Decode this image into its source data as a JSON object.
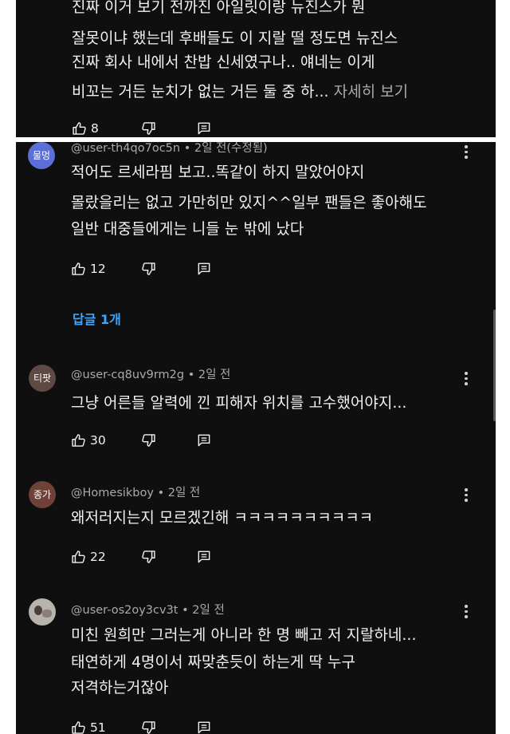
{
  "top_comment": {
    "lines": [
      "진짜 이거 보기 전까진 아일릿이랑 뉴진스가 뭔",
      "잘못이냐 했는데 후배들도 이 지랄 떨 정도면 뉴진스",
      "진짜 회사 내에서 찬밥 신세였구나.. 얘네는 이게",
      "비꼬는 거든 눈치가 없는 거든 둘 중 하..."
    ],
    "read_more": "자세히 보기",
    "likes": "8"
  },
  "comments": [
    {
      "avatar_text": "물멍",
      "avatar_color": "#5b6fd6",
      "meta": "@user-th4qo7oc5n • 2일 전(수정됨)",
      "lines": [
        "적어도 르세라핌 보고..똑같이 하지 말았어야지",
        "몰랐을리는 없고 가만히만 있지^^일부 팬들은 좋아해도",
        "일반 대중들에게는 니들 눈 밖에 났다"
      ],
      "likes": "12",
      "replies_label": "답글 1개"
    },
    {
      "avatar_text": "티팟",
      "avatar_color": "#5d4b43",
      "meta": "@user-cq8uv9rm2g • 2일 전",
      "lines": [
        "그냥 어른들 알력에 낀 피해자 위치를 고수했어야지..."
      ],
      "likes": "30"
    },
    {
      "avatar_text": "종가",
      "avatar_color": "#6e4238",
      "meta": "@Homesikboy • 2일 전",
      "lines": [
        "왜저러지는지 모르겠긴해 ㅋㅋㅋㅋㅋㅋㅋㅋㅋㅋ"
      ],
      "likes": "22"
    },
    {
      "avatar_text": "",
      "avatar_color": "#b9b3ae",
      "meta": "@user-os2oy3cv3t • 2일 전",
      "lines": [
        "미친 원희만 그러는게 아니라 한 명 빼고 저 지랄하네...",
        "태연하게 4명이서 짜맞춘듯이 하는게 딱 누구",
        "저격하는거잖아"
      ],
      "likes": "51"
    }
  ],
  "icons": {
    "like": "thumbs-up-icon",
    "dislike": "thumbs-down-icon",
    "reply": "reply-icon",
    "menu": "more-vert-icon"
  },
  "colors": {
    "background": "#0f0f0f",
    "text": "#f1f1f1",
    "secondary": "#aaaaaa",
    "link": "#3ea6ff"
  }
}
